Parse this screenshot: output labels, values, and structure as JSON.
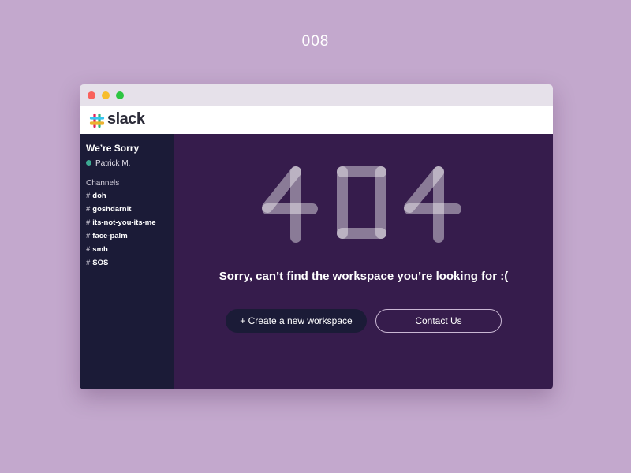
{
  "shot": {
    "number": "008"
  },
  "app": {
    "name": "slack",
    "logo_colors": [
      "#e01e5a",
      "#36c5f0",
      "#2eb67d",
      "#ecb22e"
    ]
  },
  "window": {
    "controls": [
      "close",
      "minimize",
      "zoom"
    ]
  },
  "sidebar": {
    "team_name": "We’re Sorry",
    "user": {
      "name": "Patrick M.",
      "status": "online",
      "status_color": "#3daa92"
    },
    "channels_heading": "Channels",
    "channels": [
      {
        "hash": "#",
        "name": "doh"
      },
      {
        "hash": "#",
        "name": "goshdarnit"
      },
      {
        "hash": "#",
        "name": "its-not-you-its-me"
      },
      {
        "hash": "#",
        "name": "face-palm"
      },
      {
        "hash": "#",
        "name": "smh"
      },
      {
        "hash": "#",
        "name": "SOS"
      }
    ]
  },
  "main": {
    "error_code": "404",
    "message": "Sorry, can’t find the workspace you’re looking for :(",
    "buttons": {
      "create_label": "+ Create a new workspace",
      "contact_label": "Contact Us"
    }
  },
  "colors": {
    "page_background": "#c3a8cd",
    "sidebar_background": "#1b1b37",
    "main_background": "#361c4c",
    "accent_dark": "#1b1b37"
  }
}
